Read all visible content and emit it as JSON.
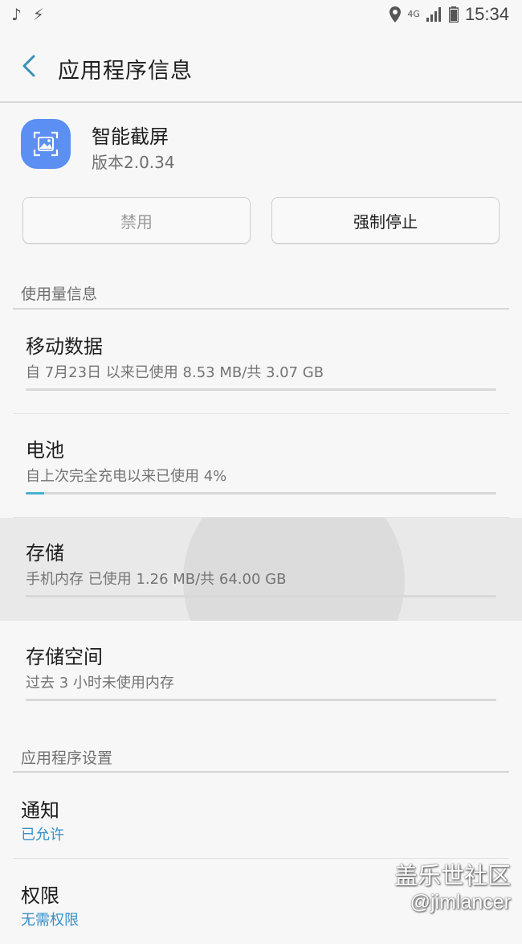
{
  "status_bar": {
    "time": "15:34",
    "network": "4G",
    "left_icons": [
      "music-note-icon",
      "flash-icon"
    ],
    "right_icons": [
      "location-icon",
      "signal-icon",
      "battery-icon"
    ]
  },
  "header": {
    "title": "应用程序信息"
  },
  "app": {
    "name": "智能截屏",
    "version": "版本2.0.34"
  },
  "buttons": {
    "disable": "禁用",
    "force_stop": "强制停止"
  },
  "usage": {
    "section_title": "使用量信息",
    "items": [
      {
        "title": "移动数据",
        "subtitle": "自 7月23日 以来已使用 8.53 MB/共 3.07 GB",
        "progress": 0.0
      },
      {
        "title": "电池",
        "subtitle": "自上次完全充电以来已使用 4%",
        "progress": 0.04
      },
      {
        "title": "存储",
        "subtitle": "手机内存 已使用 1.26 MB/共 64.00 GB",
        "progress": 0.0
      },
      {
        "title": "存储空间",
        "subtitle": "过去 3 小时未使用内存",
        "progress": 0.0
      }
    ]
  },
  "settings": {
    "section_title": "应用程序设置",
    "items": [
      {
        "title": "通知",
        "subtitle": "已允许"
      },
      {
        "title": "权限",
        "subtitle": "无需权限"
      }
    ]
  },
  "watermark": {
    "line1": "盖乐世社区",
    "line2": "@jimlancer"
  },
  "colors": {
    "accent": "#4bb1d2",
    "app_icon": "#5b8ff2",
    "link": "#3590c8"
  }
}
